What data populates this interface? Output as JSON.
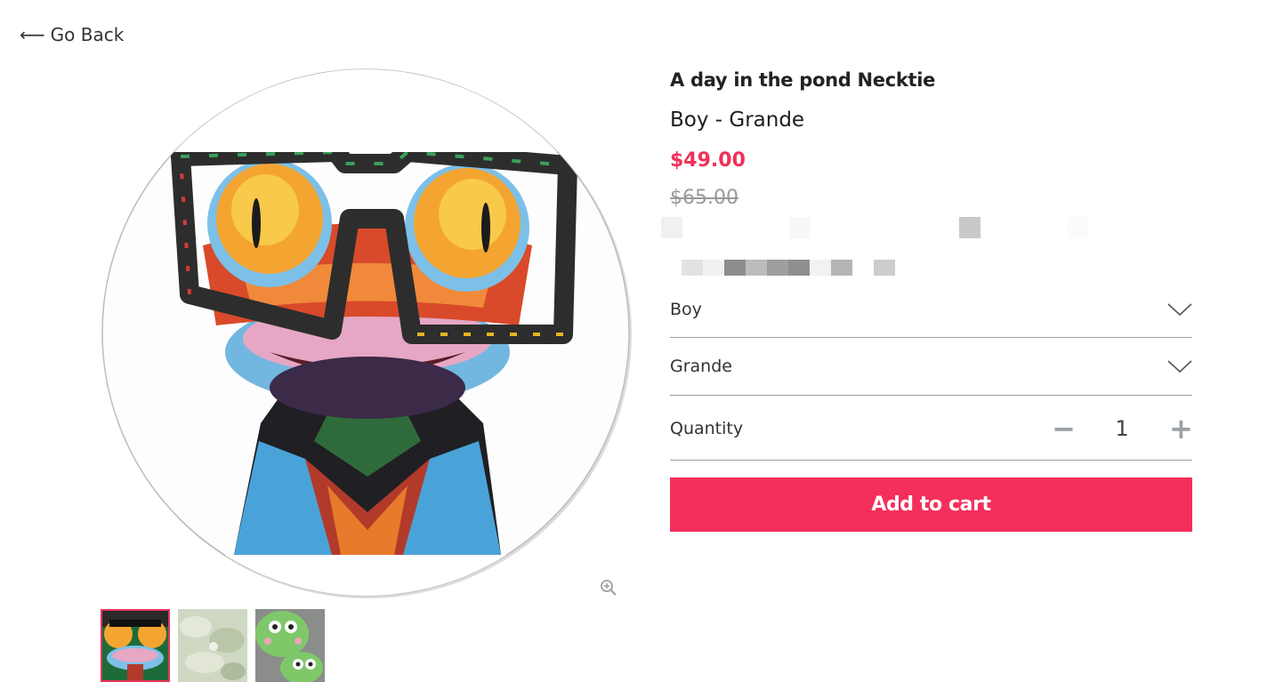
{
  "nav": {
    "back_label": "Go Back"
  },
  "product": {
    "title": "A day in the pond Necktie",
    "variant_title": "Boy - Grande",
    "price": "$49.00",
    "compare_at_price": "$65.00"
  },
  "options": {
    "option1": {
      "selected": "Boy"
    },
    "option2": {
      "selected": "Grande"
    }
  },
  "quantity": {
    "label": "Quantity",
    "value": "1",
    "decrement": "−",
    "increment": "+"
  },
  "cart": {
    "add_label": "Add to cart"
  },
  "gallery": {
    "thumbnail_count": 3,
    "active_index": 0
  },
  "colors": {
    "accent": "#f52f5c",
    "price": "#f03058",
    "divider": "#9e9e9e"
  }
}
